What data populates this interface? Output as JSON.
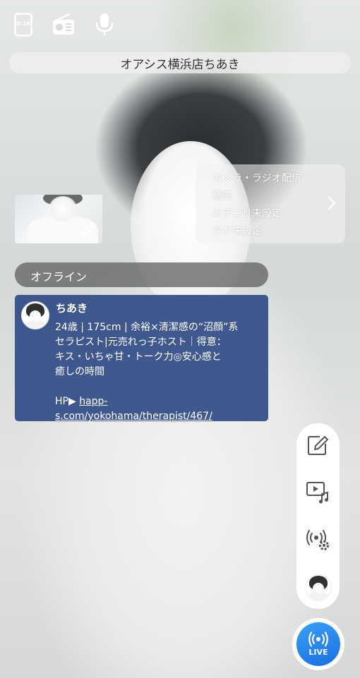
{
  "top_bar": {
    "aspect_label": "9:16",
    "icons": [
      "aspect-ratio-icon",
      "radio-icon",
      "microphone-icon"
    ]
  },
  "title": "オアシス横浜店ちあき",
  "broadcast_info": {
    "lines": [
      "カメラ・ラジオ配信",
      "標準",
      "カテゴリ未設定",
      "タグ未設定"
    ]
  },
  "status": "オフライン",
  "profile": {
    "name": "ちあき",
    "bio_lines": [
      "24歳 | 175cm | 余裕×清潔感の“沼顔”系",
      "セラピスト|元売れっ子ホスト｜得意：",
      "キス・いちゃ甘・トーク力◎安心感と",
      "癒しの時間"
    ],
    "hp_label": "HP▶ ",
    "hp_link_1": "happ-",
    "hp_link_2": "s.com/yokohama/therapist/467/"
  },
  "side_menu": {
    "icons": [
      "edit-icon",
      "video-music-icon",
      "broadcast-settings-icon",
      "profile-avatar"
    ]
  },
  "live_button": {
    "label": "LIVE"
  },
  "colors": {
    "profile_card": "#304c86",
    "live_blue": "#1a6fe0",
    "status_pill": "#5a5a5a"
  }
}
